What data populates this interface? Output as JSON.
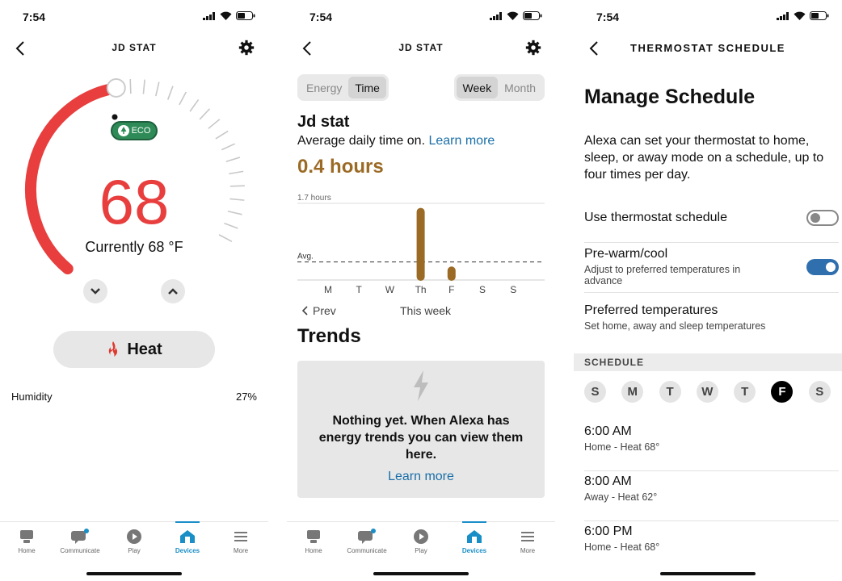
{
  "status": {
    "time": "7:54"
  },
  "screen1": {
    "title": "JD STAT",
    "temperature": "68",
    "current": "Currently 68 °F",
    "eco_label": "ECO",
    "mode_label": "Heat",
    "humidity_label": "Humidity",
    "humidity_value": "27%",
    "setpoint_fraction": 0.5,
    "colors": {
      "accent": "#e83e3e",
      "eco": "#2e8b57"
    }
  },
  "screen2": {
    "title": "JD STAT",
    "seg_energy": "Energy",
    "seg_time": "Time",
    "seg_week": "Week",
    "seg_month": "Month",
    "device": "Jd stat",
    "avg_text": "Average daily time on.",
    "learn_more": "Learn more",
    "hours": "0.4 hours",
    "prev": "Prev",
    "this_week": "This week",
    "trends_title": "Trends",
    "empty_msg": "Nothing yet. When Alexa has energy trends you can view them here.",
    "empty_link": "Learn more",
    "chart_data": {
      "type": "bar",
      "categories": [
        "M",
        "T",
        "W",
        "Th",
        "F",
        "S",
        "S"
      ],
      "values": [
        0,
        0,
        0,
        1.6,
        0.3,
        0,
        0
      ],
      "ylim": [
        0,
        1.7
      ],
      "max_label": "1.7 hours",
      "avg_label": "Avg.",
      "avg_value": 0.4,
      "bar_color": "#9b6a25"
    }
  },
  "screen3": {
    "title": "THERMOSTAT SCHEDULE",
    "heading": "Manage Schedule",
    "description": "Alexa can set your thermostat to home, sleep, or away mode on a schedule, up to four times per day.",
    "use_schedule": "Use thermostat schedule",
    "prewarm": "Pre-warm/cool",
    "prewarm_sub": "Adjust to preferred temperatures in advance",
    "preferred": "Preferred temperatures",
    "preferred_sub": "Set home, away and sleep temperatures",
    "schedule_header": "SCHEDULE",
    "days": [
      "S",
      "M",
      "T",
      "W",
      "T",
      "F",
      "S"
    ],
    "selected_day": 5,
    "slots": [
      {
        "time": "6:00 AM",
        "detail": "Home - Heat 68°"
      },
      {
        "time": "8:00 AM",
        "detail": "Away - Heat 62°"
      },
      {
        "time": "6:00 PM",
        "detail": "Home - Heat 68°"
      }
    ],
    "toggle_color": "#2f6fae"
  },
  "tabs": [
    "Home",
    "Communicate",
    "Play",
    "Devices",
    "More"
  ]
}
